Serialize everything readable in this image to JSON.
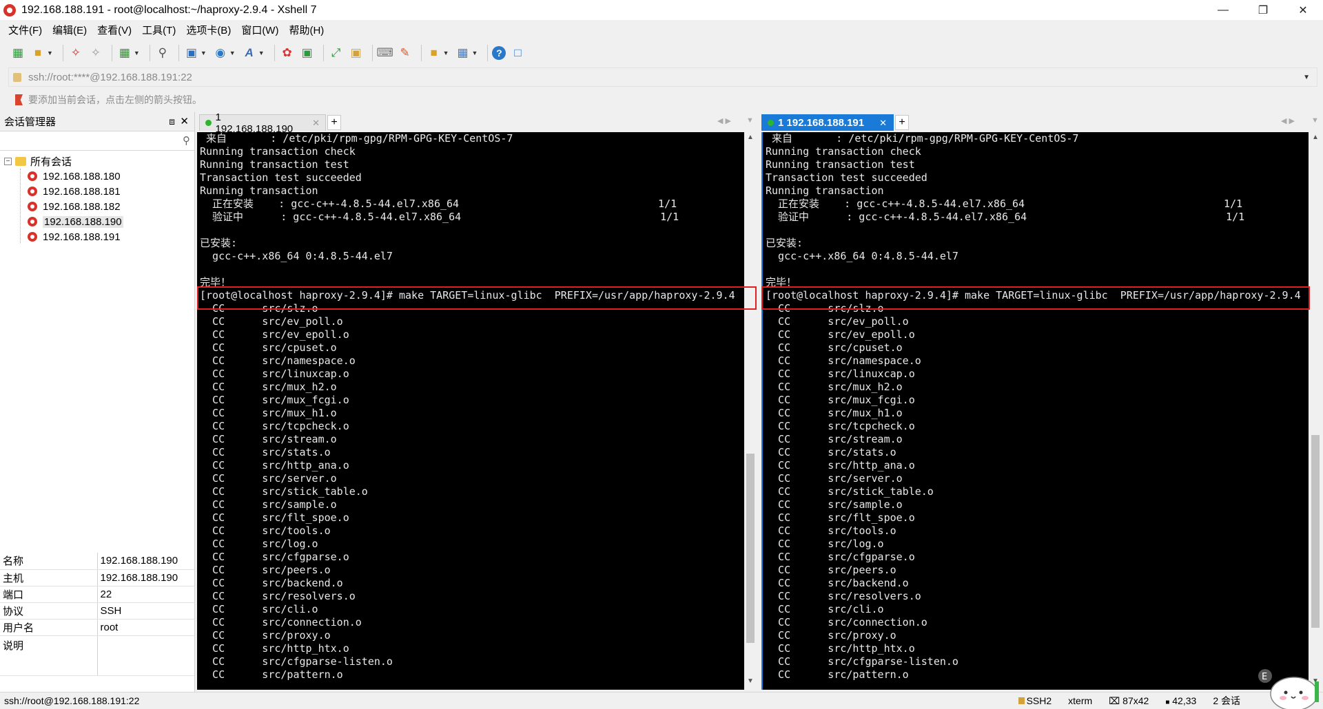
{
  "window": {
    "title": "192.168.188.191 - root@localhost:~/haproxy-2.9.4 - Xshell 7"
  },
  "menu": [
    "文件(F)",
    "编辑(E)",
    "查看(V)",
    "工具(T)",
    "选项卡(B)",
    "窗口(W)",
    "帮助(H)"
  ],
  "address": {
    "value": "ssh://root:****@192.168.188.191:22"
  },
  "hint": "要添加当前会话，点击左侧的箭头按钮。",
  "session_panel": {
    "title": "会话管理器",
    "root_label": "所有会话",
    "sessions": [
      "192.168.188.180",
      "192.168.188.181",
      "192.168.188.182",
      "192.168.188.190",
      "192.168.188.191"
    ],
    "selected_index": 3
  },
  "properties": [
    {
      "key": "名称",
      "value": "192.168.188.190"
    },
    {
      "key": "主机",
      "value": "192.168.188.190"
    },
    {
      "key": "端口",
      "value": "22"
    },
    {
      "key": "协议",
      "value": "SSH"
    },
    {
      "key": "用户名",
      "value": "root"
    },
    {
      "key": "说明",
      "value": ""
    }
  ],
  "left_tab": {
    "label": "1 192.168.188.190"
  },
  "right_tab": {
    "label": "1 192.168.188.191"
  },
  "terminal_lines": [
    " 来自       : /etc/pki/rpm-gpg/RPM-GPG-KEY-CentOS-7",
    "Running transaction check",
    "Running transaction test",
    "Transaction test succeeded",
    "Running transaction",
    "  正在安装    : gcc-c++-4.8.5-44.el7.x86_64                                1/1",
    "  验证中      : gcc-c++-4.8.5-44.el7.x86_64                                1/1",
    "",
    "已安装:",
    "  gcc-c++.x86_64 0:4.8.5-44.el7",
    "",
    "完毕！",
    "[root@localhost haproxy-2.9.4]# make TARGET=linux-glibc  PREFIX=/usr/app/haproxy-2.9.4",
    "  CC      src/slz.o",
    "  CC      src/ev_poll.o",
    "  CC      src/ev_epoll.o",
    "  CC      src/cpuset.o",
    "  CC      src/namespace.o",
    "  CC      src/linuxcap.o",
    "  CC      src/mux_h2.o",
    "  CC      src/mux_fcgi.o",
    "  CC      src/mux_h1.o",
    "  CC      src/tcpcheck.o",
    "  CC      src/stream.o",
    "  CC      src/stats.o",
    "  CC      src/http_ana.o",
    "  CC      src/server.o",
    "  CC      src/stick_table.o",
    "  CC      src/sample.o",
    "  CC      src/flt_spoe.o",
    "  CC      src/tools.o",
    "  CC      src/log.o",
    "  CC      src/cfgparse.o",
    "  CC      src/peers.o",
    "  CC      src/backend.o",
    "  CC      src/resolvers.o",
    "  CC      src/cli.o",
    "  CC      src/connection.o",
    "  CC      src/proxy.o",
    "  CC      src/http_htx.o",
    "  CC      src/cfgparse-listen.o",
    "  CC      src/pattern.o"
  ],
  "status": {
    "left": "ssh://root@192.168.188.191:22",
    "protocol": "SSH2",
    "term": "xterm",
    "size": "87x42",
    "cursor": "42,33",
    "sessions": "2 会话"
  },
  "colors": {
    "terminal_bg": "#000000",
    "terminal_fg": "#e8e8e8",
    "active_tab": "#1a7ad8",
    "highlight": "#e02020"
  }
}
